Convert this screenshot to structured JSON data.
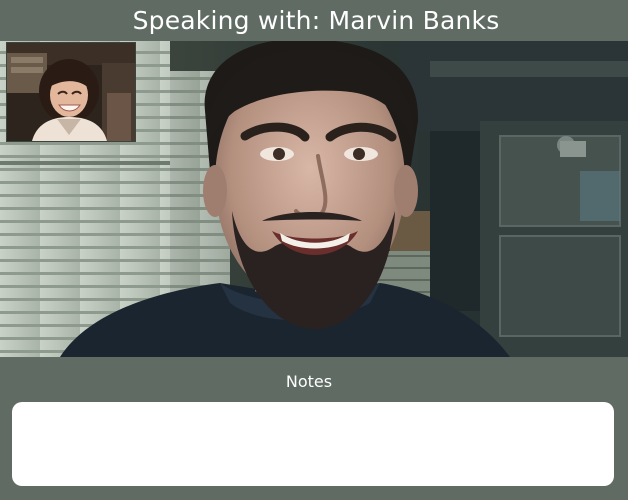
{
  "header": {
    "title": "Speaking with: Marvin Banks"
  },
  "remote_video": {
    "participant": "Marvin Banks"
  },
  "notes": {
    "label": "Notes",
    "value": "",
    "placeholder": ""
  },
  "colors": {
    "background": "#5f6b63",
    "notes_box": "#ffffff",
    "text": "#ffffff"
  }
}
